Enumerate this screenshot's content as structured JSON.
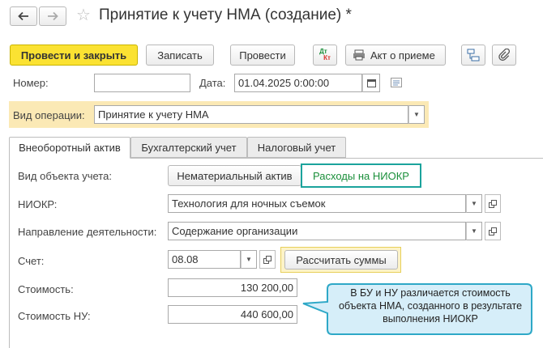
{
  "window": {
    "title": "Принятие к учету НМА (создание) *"
  },
  "toolbar": {
    "post_close_label": "Провести и закрыть",
    "save_label": "Записать",
    "post_label": "Провести",
    "dt_kt_top": "Дт",
    "dt_kt_bottom": "Кт",
    "act_label": "Акт о приеме"
  },
  "header": {
    "number_label": "Номер:",
    "number_value": "",
    "date_label": "Дата:",
    "date_value": "01.04.2025  0:00:00",
    "operation_label": "Вид операции:",
    "operation_value": "Принятие к учету НМА"
  },
  "tabs": [
    {
      "label": "Внеоборотный актив",
      "active": true
    },
    {
      "label": "Бухгалтерский учет",
      "active": false
    },
    {
      "label": "Налоговый учет",
      "active": false
    }
  ],
  "form": {
    "object_type_label": "Вид объекта учета:",
    "object_type_options": [
      "Нематериальный актив",
      "Расходы на НИОКР"
    ],
    "object_type_selected": "Расходы на НИОКР",
    "niokr_label": "НИОКР:",
    "niokr_value": "Технология для ночных съемок",
    "direction_label": "Направление деятельности:",
    "direction_value": "Содержание организации",
    "account_label": "Счет:",
    "account_value": "08.08",
    "calc_label": "Рассчитать суммы",
    "cost_label": "Стоимость:",
    "cost_value": "130 200,00",
    "cost_nu_label": "Стоимость НУ:",
    "cost_nu_value": "440 600,00"
  },
  "callout": {
    "text": "В БУ и НУ различается стоимость объекта НМА, созданного в результате выполнения НИОКР"
  },
  "colors": {
    "primary_button": "#fbe232",
    "highlight_field": "#fbe9b5",
    "selected_toggle": "#1ba39c",
    "callout_fill": "#d6eef9",
    "callout_border": "#2ea8c7"
  }
}
